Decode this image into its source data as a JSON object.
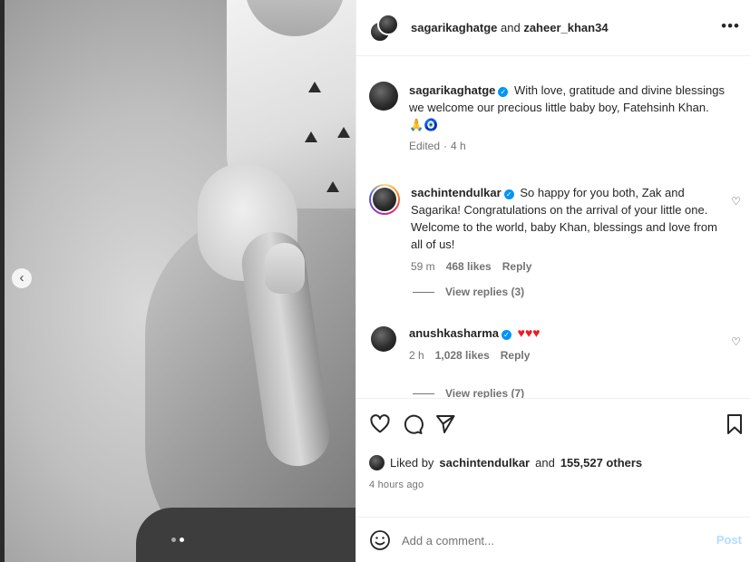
{
  "header": {
    "user1": "sagarikaghatge",
    "joiner": "and",
    "user2": "zaheer_khan34",
    "more_icon": "more-options-icon"
  },
  "caption": {
    "username": "sagarikaghatge",
    "verified": true,
    "text": "With love, gratitude and divine blessings we welcome our precious little baby boy, Fatehsinh Khan.",
    "emojis": "🙏🧿",
    "edited": "Edited",
    "time": "4 h"
  },
  "comments": [
    {
      "username": "sachintendulkar",
      "verified": true,
      "text": "So happy for you both, Zak and Sagarika! Congratulations on the arrival of your little one. Welcome to the world, baby Khan, blessings and love from all of us!",
      "time": "59 m",
      "likes": "468 likes",
      "reply_label": "Reply",
      "view_replies": "View replies (3)"
    },
    {
      "username": "anushkasharma",
      "verified": true,
      "text": "♥♥♥",
      "time": "2 h",
      "likes": "1,028 likes",
      "reply_label": "Reply",
      "view_replies": "View replies (7)"
    }
  ],
  "likes": {
    "prefix": "Liked by",
    "user": "sachintendulkar",
    "joiner": "and",
    "others": "155,527 others"
  },
  "post_time": "4 hours ago",
  "add_comment": {
    "placeholder": "Add a comment...",
    "post_label": "Post"
  },
  "colors": {
    "accent": "#0095f6",
    "post_disabled": "#b3dbff",
    "heart_red": "#ed1c24",
    "muted_text": "#737373"
  }
}
